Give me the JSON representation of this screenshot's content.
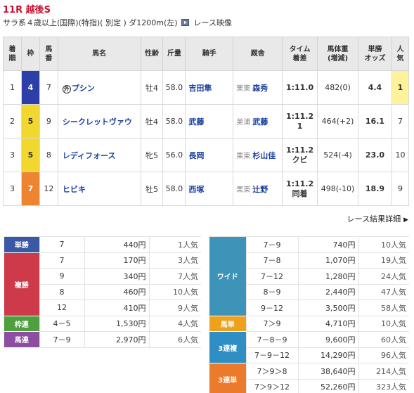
{
  "race": {
    "title": "11R 越後S",
    "info": "サラ系４歳以上(国際)(特指)( 別定 ) ダ1200m(左)",
    "movie_label": "レース映像"
  },
  "table": {
    "headers": {
      "rank": [
        "着",
        "順"
      ],
      "waku": "枠",
      "num": [
        "馬",
        "番"
      ],
      "horse": "馬名",
      "sex_age": "性齢",
      "weight": "斤量",
      "jockey": "騎手",
      "trainer": "厩舎",
      "time": [
        "タイム",
        "着差"
      ],
      "body_weight": [
        "馬体重",
        "(増減)"
      ],
      "odds": [
        "単勝",
        "オッズ"
      ],
      "pop": [
        "人",
        "気"
      ]
    },
    "rows": [
      {
        "rank": "1",
        "waku": "4",
        "num": "7",
        "mark": "外",
        "horse": "プシン",
        "sex_age": "牡4",
        "weight": "58.0",
        "jockey": "吉田隼",
        "aff": "栗東",
        "trainer": "森秀",
        "time": "1:11.0",
        "margin": "",
        "body_weight": "482(0)",
        "odds": "4.4",
        "pop": "1"
      },
      {
        "rank": "2",
        "waku": "5",
        "num": "9",
        "mark": "",
        "horse": "シークレットヴァウ",
        "sex_age": "牡4",
        "weight": "58.0",
        "jockey": "武藤",
        "aff": "美浦",
        "trainer": "武藤",
        "time": "1:11.2",
        "margin": "1",
        "body_weight": "464(+2)",
        "odds": "16.1",
        "pop": "7"
      },
      {
        "rank": "3",
        "waku": "5",
        "num": "8",
        "mark": "",
        "horse": "レディフォース",
        "sex_age": "牝5",
        "weight": "56.0",
        "jockey": "長岡",
        "aff": "栗東",
        "trainer": "杉山佳",
        "time": "1:11.2",
        "margin": "クビ",
        "body_weight": "524(-4)",
        "odds": "23.0",
        "pop": "10"
      },
      {
        "rank": "3",
        "waku": "7",
        "num": "12",
        "mark": "",
        "horse": "ヒビキ",
        "sex_age": "牡5",
        "weight": "58.0",
        "jockey": "西塚",
        "aff": "栗東",
        "trainer": "辻野",
        "time": "1:11.2",
        "margin": "同着",
        "body_weight": "498(-10)",
        "odds": "18.9",
        "pop": "9"
      }
    ]
  },
  "detail_link": "レース結果詳細",
  "payouts_left": [
    {
      "label": "単勝",
      "color": "#3a59a4",
      "rows": [
        [
          "7",
          "440円",
          "1人気"
        ]
      ]
    },
    {
      "label": "複勝",
      "color": "#cf3a4b",
      "rows": [
        [
          "7",
          "170円",
          "3人気"
        ],
        [
          "9",
          "340円",
          "7人気"
        ],
        [
          "8",
          "460円",
          "10人気"
        ],
        [
          "12",
          "410円",
          "9人気"
        ]
      ]
    },
    {
      "label": "枠連",
      "color": "#4e9f3d",
      "rows": [
        [
          "4－5",
          "1,530円",
          "4人気"
        ]
      ]
    },
    {
      "label": "馬連",
      "color": "#8d4da0",
      "rows": [
        [
          "7－9",
          "2,970円",
          "6人気"
        ]
      ]
    }
  ],
  "payouts_right": [
    {
      "label": "ワイド",
      "color": "#3d93b8",
      "rows": [
        [
          "7－9",
          "740円",
          "10人気"
        ],
        [
          "7－8",
          "1,070円",
          "19人気"
        ],
        [
          "7－12",
          "1,280円",
          "24人気"
        ],
        [
          "8－9",
          "2,440円",
          "47人気"
        ],
        [
          "9－12",
          "3,500円",
          "58人気"
        ]
      ]
    },
    {
      "label": "馬単",
      "color": "#f0a11c",
      "rows": [
        [
          "7＞9",
          "4,710円",
          "10人気"
        ]
      ]
    },
    {
      "label": "3連複",
      "color": "#2f8fc4",
      "rows": [
        [
          "7－8－9",
          "9,600円",
          "60人気"
        ],
        [
          "7－9－12",
          "14,290円",
          "96人気"
        ]
      ]
    },
    {
      "label": "3連単",
      "color": "#ec7a2c",
      "rows": [
        [
          "7＞9＞8",
          "38,640円",
          "214人気"
        ],
        [
          "7＞9＞12",
          "52,260円",
          "323人気"
        ]
      ]
    }
  ]
}
